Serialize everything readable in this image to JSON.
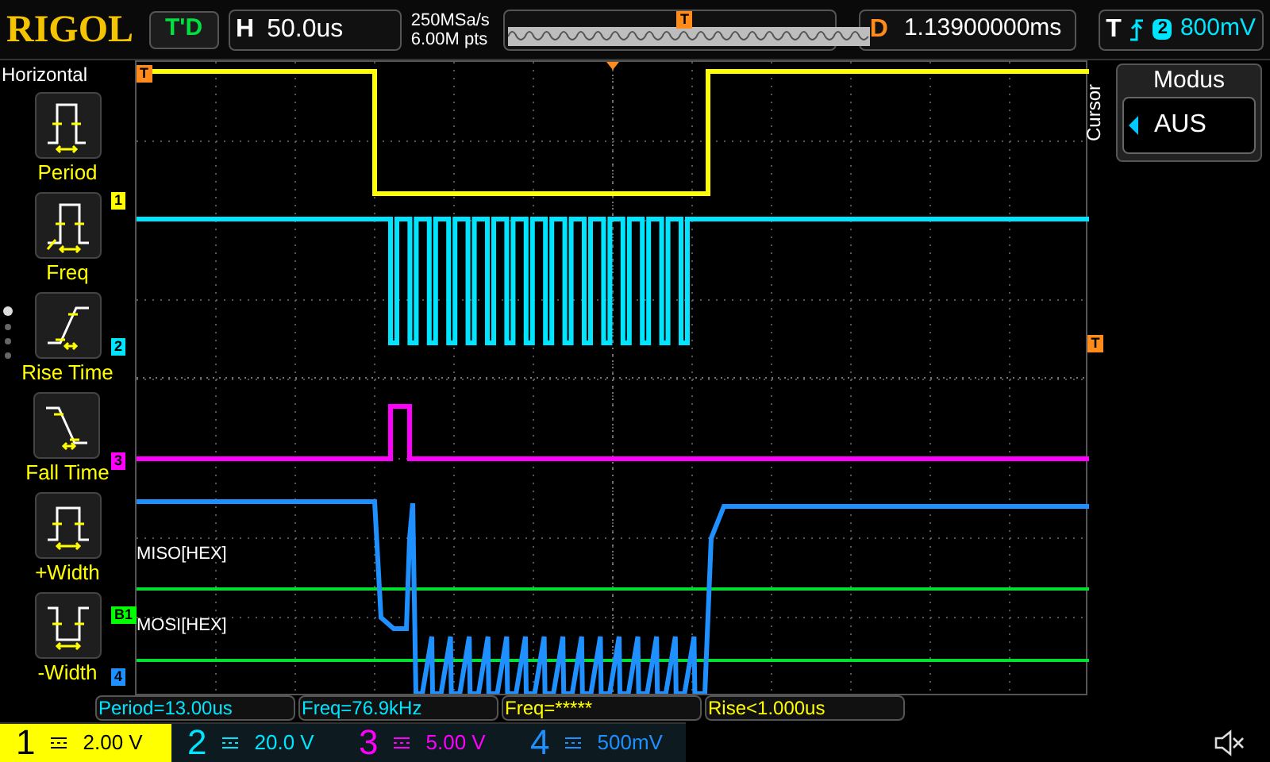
{
  "header": {
    "logo": "RIGOL",
    "run_state": "T'D",
    "timebase_label": "H",
    "timebase": "50.0us",
    "sample_rate": "250MSa/s",
    "memory_depth": "6.00M pts",
    "overview_marker": "T",
    "delay_label": "D",
    "delay": "1.13900000ms",
    "trigger_label": "T",
    "trigger_source": "2",
    "trigger_level": "800mV"
  },
  "menu": {
    "title": "Horizontal",
    "items": [
      {
        "kind": "period",
        "label": "Period"
      },
      {
        "kind": "freq",
        "label": "Freq"
      },
      {
        "kind": "rise",
        "label": "Rise Time"
      },
      {
        "kind": "fall",
        "label": "Fall Time"
      },
      {
        "kind": "pwidth",
        "label": "+Width"
      },
      {
        "kind": "nwidth",
        "label": "-Width"
      }
    ],
    "page_dots": [
      {
        "selected": true
      },
      {
        "selected": false
      },
      {
        "selected": false
      },
      {
        "selected": false
      }
    ]
  },
  "graticule": {
    "markers": [
      {
        "text": "T",
        "color": "#ff8c1a"
      },
      {
        "text": "1",
        "color": "#ffff00"
      },
      {
        "text": "2",
        "color": "#00e5ff"
      },
      {
        "text": "3",
        "color": "#ff00ff"
      },
      {
        "text": "B1",
        "color": "#00ff00"
      },
      {
        "text": "4",
        "color": "#1e90ff"
      }
    ],
    "bus_labels": [
      "MISO[HEX]",
      "MOSI[HEX]"
    ],
    "right_marker": "T"
  },
  "side_panel": {
    "title": "Cursor",
    "field_label": "Modus",
    "field_value": "AUS"
  },
  "measurements": [
    {
      "text": "Period=13.00us",
      "color": "#00e5ff"
    },
    {
      "text": "Freq=76.9kHz",
      "color": "#00e5ff"
    },
    {
      "text": "Freq=*****",
      "color": "#ffff00"
    },
    {
      "text": "Rise<1.000us",
      "color": "#ffff00"
    }
  ],
  "channels": [
    {
      "number": "1",
      "scale": "2.00 V",
      "color": "#ffff00",
      "selected": true
    },
    {
      "number": "2",
      "scale": "20.0 V",
      "color": "#00e5ff",
      "selected": false
    },
    {
      "number": "3",
      "scale": "5.00 V",
      "color": "#ff00ff",
      "selected": false
    },
    {
      "number": "4",
      "scale": "500mV",
      "color": "#1e90ff",
      "selected": false
    }
  ]
}
